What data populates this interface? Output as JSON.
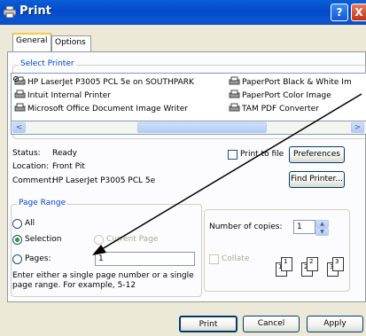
{
  "window": {
    "title": "Print",
    "help_glyph": "?",
    "close_glyph": "X"
  },
  "tabs": [
    {
      "label": "General",
      "selected": true
    },
    {
      "label": "Options",
      "selected": false
    }
  ],
  "select_printer": {
    "legend": "Select Printer",
    "printers": [
      {
        "name": "HP LaserJet P3005 PCL 5e on SOUTHPARK",
        "selected": true
      },
      {
        "name": "Intuit Internal Printer"
      },
      {
        "name": "Microsoft Office Document Image Writer"
      },
      {
        "name": "PaperPort Black & White Im"
      },
      {
        "name": "PaperPort Color Image"
      },
      {
        "name": "TAM PDF Converter"
      }
    ],
    "scroll_left": "<",
    "scroll_right": ">"
  },
  "printer_info": {
    "status_label": "Status:",
    "status_value": "Ready",
    "location_label": "Location:",
    "location_value": "Front Pit",
    "comment_label": "Comment:",
    "comment_value": "HP LaserJet P3005 PCL 5e"
  },
  "print_to_file": {
    "label": "Print to file",
    "checked": false
  },
  "buttons": {
    "preferences": "Preferences",
    "find_printer": "Find Printer...",
    "print": "Print",
    "cancel": "Cancel",
    "apply": "Apply"
  },
  "page_range": {
    "legend": "Page Range",
    "all": "All",
    "selection": "Selection",
    "current_page": "Current Page",
    "pages": "Pages:",
    "pages_value": "1",
    "selected_option": "Selection",
    "help_line1": "Enter either a single page number or a single",
    "help_line2": "page range.  For example, 5-12"
  },
  "copies": {
    "label": "Number of copies:",
    "value": "1",
    "collate_label": "Collate",
    "collate_pages": [
      "1",
      "1",
      "2",
      "2",
      "3",
      "3"
    ]
  },
  "colors": {
    "title_bar": "#0a5fd8",
    "legend": "#0046d5",
    "radio_dot": "#21a121"
  }
}
